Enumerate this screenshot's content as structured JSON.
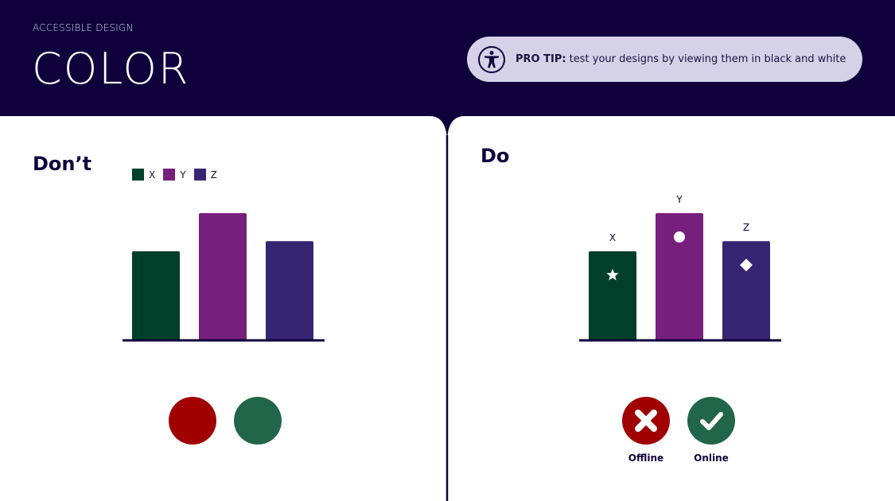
{
  "header": {
    "eyebrow": "ACCESSIBLE DESIGN",
    "title": "COLOR",
    "tip_label": "PRO TIP:",
    "tip_text": " test your designs by viewing them in black and white",
    "tip_icon": "accessibility-icon"
  },
  "colors": {
    "header_bg": "#0f003c",
    "tip_bg": "#d5d2e7",
    "x": "#00402a",
    "y": "#771f7c",
    "z": "#362572",
    "offline": "#a10000",
    "online": "#216648"
  },
  "dont": {
    "heading": "Don’t",
    "legend": [
      {
        "label": "X",
        "color": "#00402a"
      },
      {
        "label": "Y",
        "color": "#771f7c"
      },
      {
        "label": "Z",
        "color": "#362572"
      }
    ],
    "status_icons": [
      "red-circle",
      "green-circle"
    ]
  },
  "do": {
    "heading": "Do",
    "status": [
      {
        "label": "Offline",
        "icon": "x-icon"
      },
      {
        "label": "Online",
        "icon": "check-icon"
      }
    ]
  },
  "chart_data": [
    {
      "type": "bar",
      "title": "Don’t",
      "categories": [
        "X",
        "Y",
        "Z"
      ],
      "values": [
        7,
        10,
        7.8
      ],
      "legend": "top-left",
      "ylim": [
        0,
        10
      ],
      "markers": [],
      "direct_labels": false
    },
    {
      "type": "bar",
      "title": "Do",
      "categories": [
        "X",
        "Y",
        "Z"
      ],
      "values": [
        7,
        10,
        7.8
      ],
      "ylim": [
        0,
        10
      ],
      "markers": [
        "star",
        "circle",
        "diamond"
      ],
      "direct_labels": true
    }
  ]
}
